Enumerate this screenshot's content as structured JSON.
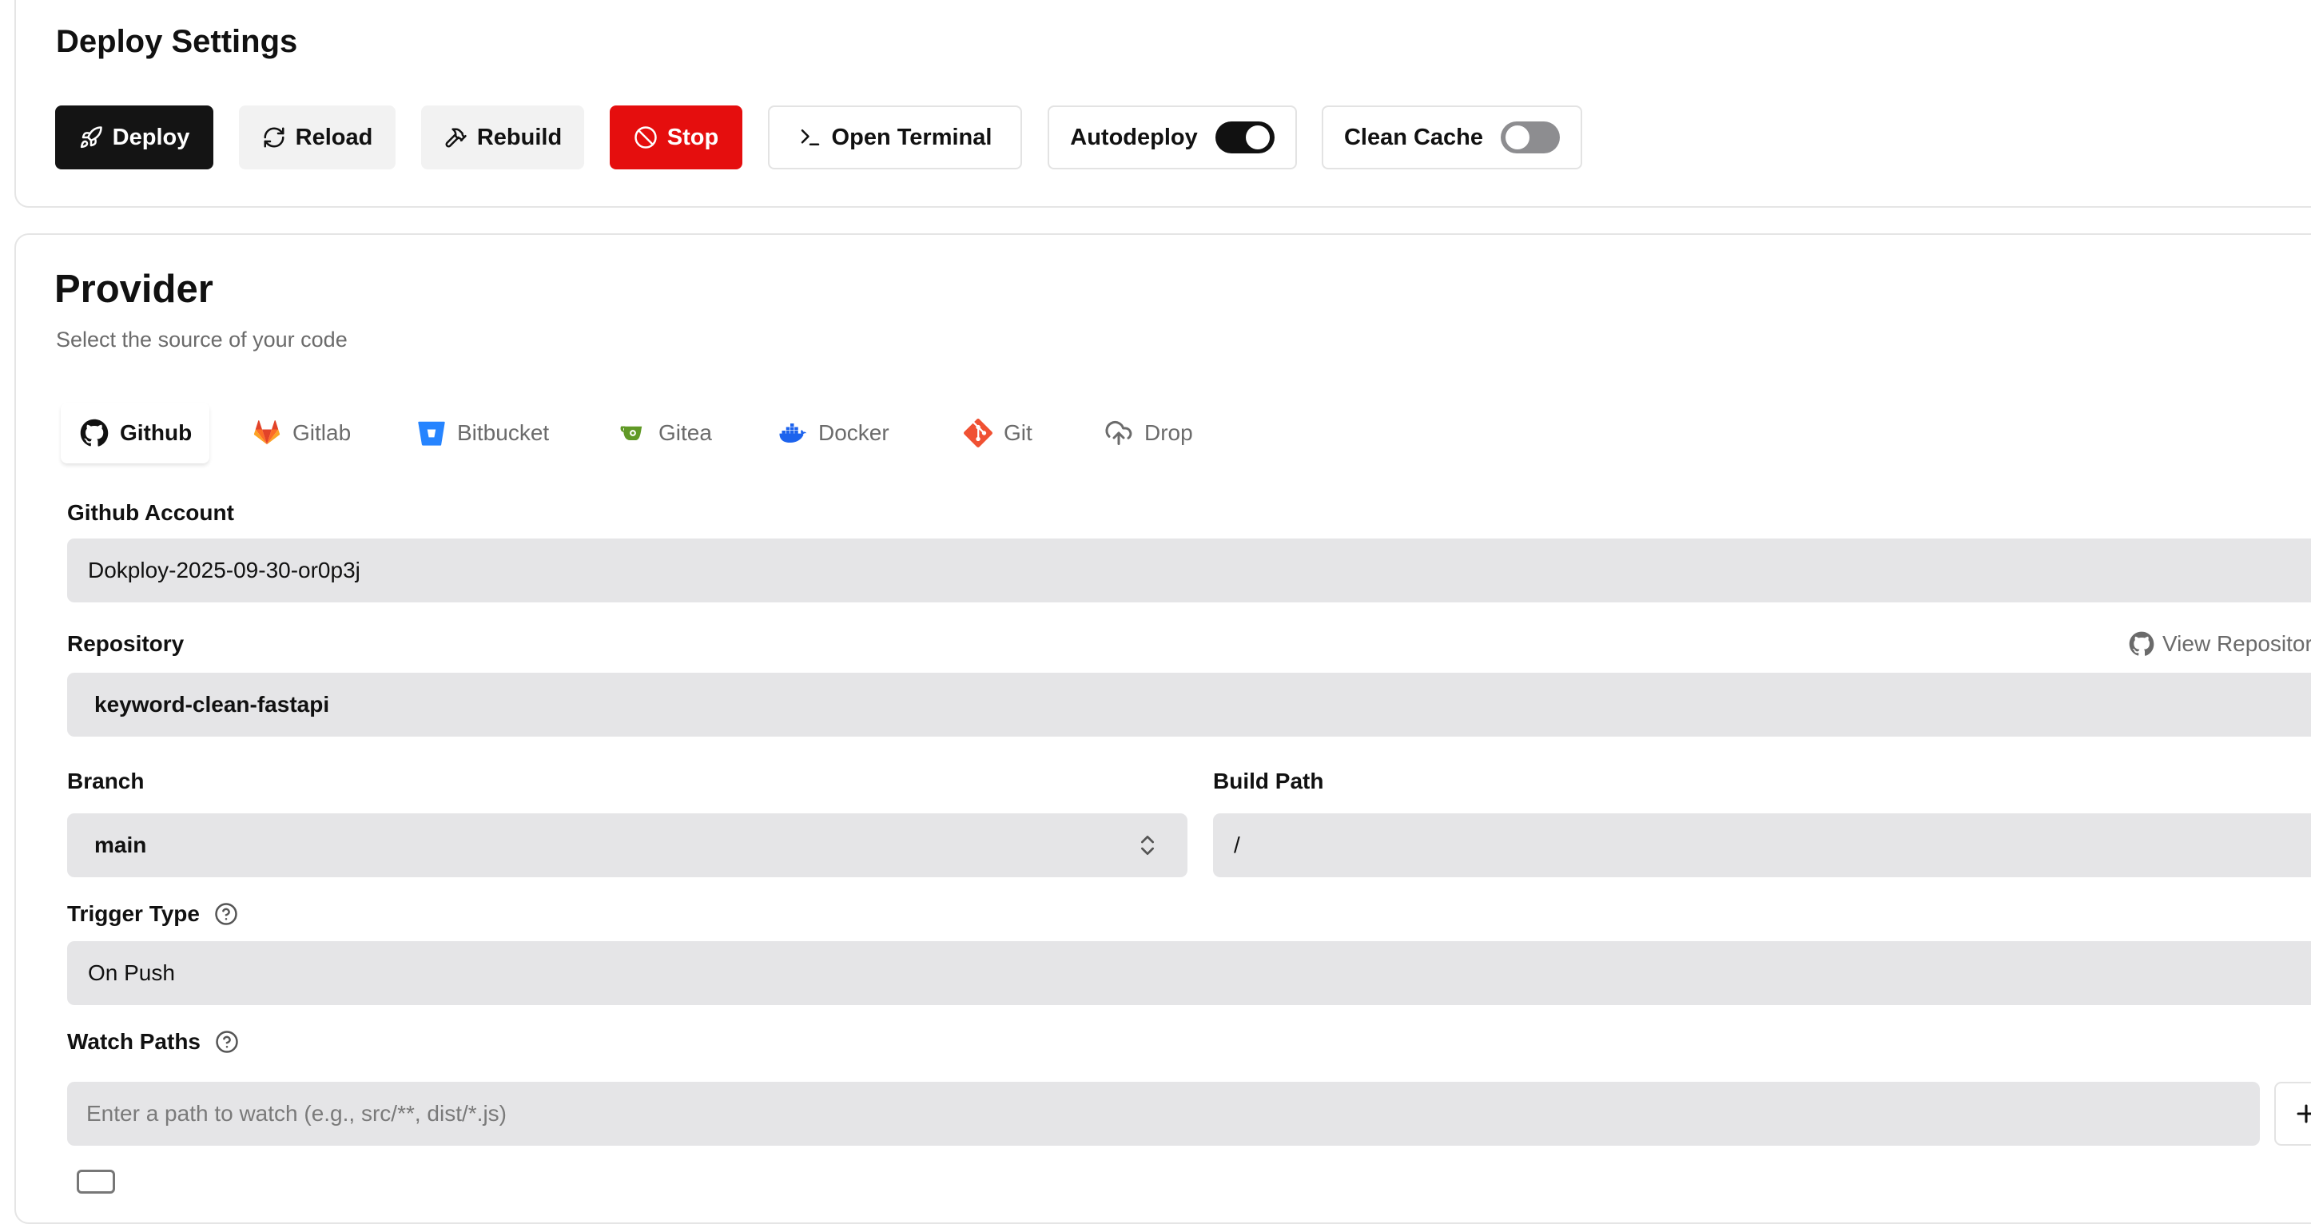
{
  "deploy_settings": {
    "title": "Deploy Settings",
    "buttons": {
      "deploy": "Deploy",
      "reload": "Reload",
      "rebuild": "Rebuild",
      "stop": "Stop",
      "open_terminal": "Open Terminal",
      "autodeploy": "Autodeploy",
      "clean_cache": "Clean Cache"
    },
    "toggles": {
      "autodeploy_on": true,
      "clean_cache_on": false
    }
  },
  "provider": {
    "title": "Provider",
    "subtitle": "Select the source of your code",
    "tabs": [
      {
        "label": "Github",
        "icon": "github-icon",
        "active": true
      },
      {
        "label": "Gitlab",
        "icon": "gitlab-icon",
        "active": false
      },
      {
        "label": "Bitbucket",
        "icon": "bitbucket-icon",
        "active": false
      },
      {
        "label": "Gitea",
        "icon": "gitea-icon",
        "active": false
      },
      {
        "label": "Docker",
        "icon": "docker-icon",
        "active": false
      },
      {
        "label": "Git",
        "icon": "git-icon",
        "active": false
      },
      {
        "label": "Drop",
        "icon": "cloud-upload-icon",
        "active": false
      }
    ],
    "form": {
      "github_account_label": "Github Account",
      "github_account_value": "Dokploy-2025-09-30-or0p3j",
      "repository_label": "Repository",
      "view_repository": "View Repository",
      "repository_value": "keyword-clean-fastapi",
      "branch_label": "Branch",
      "branch_value": "main",
      "build_path_label": "Build Path",
      "build_path_value": "/",
      "trigger_type_label": "Trigger Type",
      "trigger_type_value": "On Push",
      "watch_paths_label": "Watch Paths",
      "watch_paths_placeholder": "Enter a path to watch (e.g., src/**, dist/*.js)"
    }
  },
  "colors": {
    "primary_dark": "#141414",
    "danger": "#e50e0e",
    "input_bg": "#e5e5e7",
    "muted_text": "#6b6b6b",
    "gitlab": "#e24329",
    "bitbucket": "#2684ff",
    "gitea": "#609926",
    "docker": "#1d63ed",
    "git": "#f05133"
  }
}
